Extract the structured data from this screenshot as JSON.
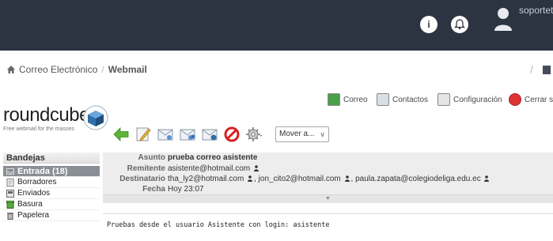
{
  "topbar": {
    "info_icon": "info-icon",
    "bell_icon": "bell-icon",
    "user": "soportet"
  },
  "breadcrumb": {
    "items": [
      "Correo Electrónico",
      "Webmail"
    ],
    "separator": "/"
  },
  "roundcube": {
    "logo_text": "roundcube",
    "tagline": "Free webmail for the masses",
    "nav": [
      {
        "label": "Correo",
        "icon": "mail-icon"
      },
      {
        "label": "Contactos",
        "icon": "contacts-icon"
      },
      {
        "label": "Configuración",
        "icon": "settings-icon"
      },
      {
        "label": "Cerrar sesión",
        "icon": "logout-icon"
      }
    ]
  },
  "toolbar": {
    "buttons": [
      "back-arrow-icon",
      "compose-icon",
      "reply-icon",
      "reply-all-icon",
      "forward-icon",
      "delete-icon",
      "more-gear-icon"
    ],
    "move_select": "Mover a..."
  },
  "mailboxes": {
    "title": "Bandejas",
    "folders": [
      {
        "label": "Entrada (18)",
        "active": true
      },
      {
        "label": "Borradores"
      },
      {
        "label": "Enviados"
      },
      {
        "label": "Basura"
      },
      {
        "label": "Papelera"
      }
    ]
  },
  "message": {
    "subject_label": "Asunto",
    "subject": "prueba correo asistente",
    "from_label": "Remitente",
    "from": "asistente@hotmail.com",
    "to_label": "Destinatario",
    "to": [
      "tha_ly2@hotmail.com",
      "jon_cito2@hotmail.com",
      "paula.zapata@colegiodeliga.edu.ec"
    ],
    "date_label": "Fecha",
    "date": "Hoy 23:07",
    "body": "Pruebas desde el usuario Asistente con login: asistente"
  },
  "colors": {
    "topbar": "#2c3341",
    "active_folder": "#8a8f96",
    "header_bg": "#ededed"
  }
}
